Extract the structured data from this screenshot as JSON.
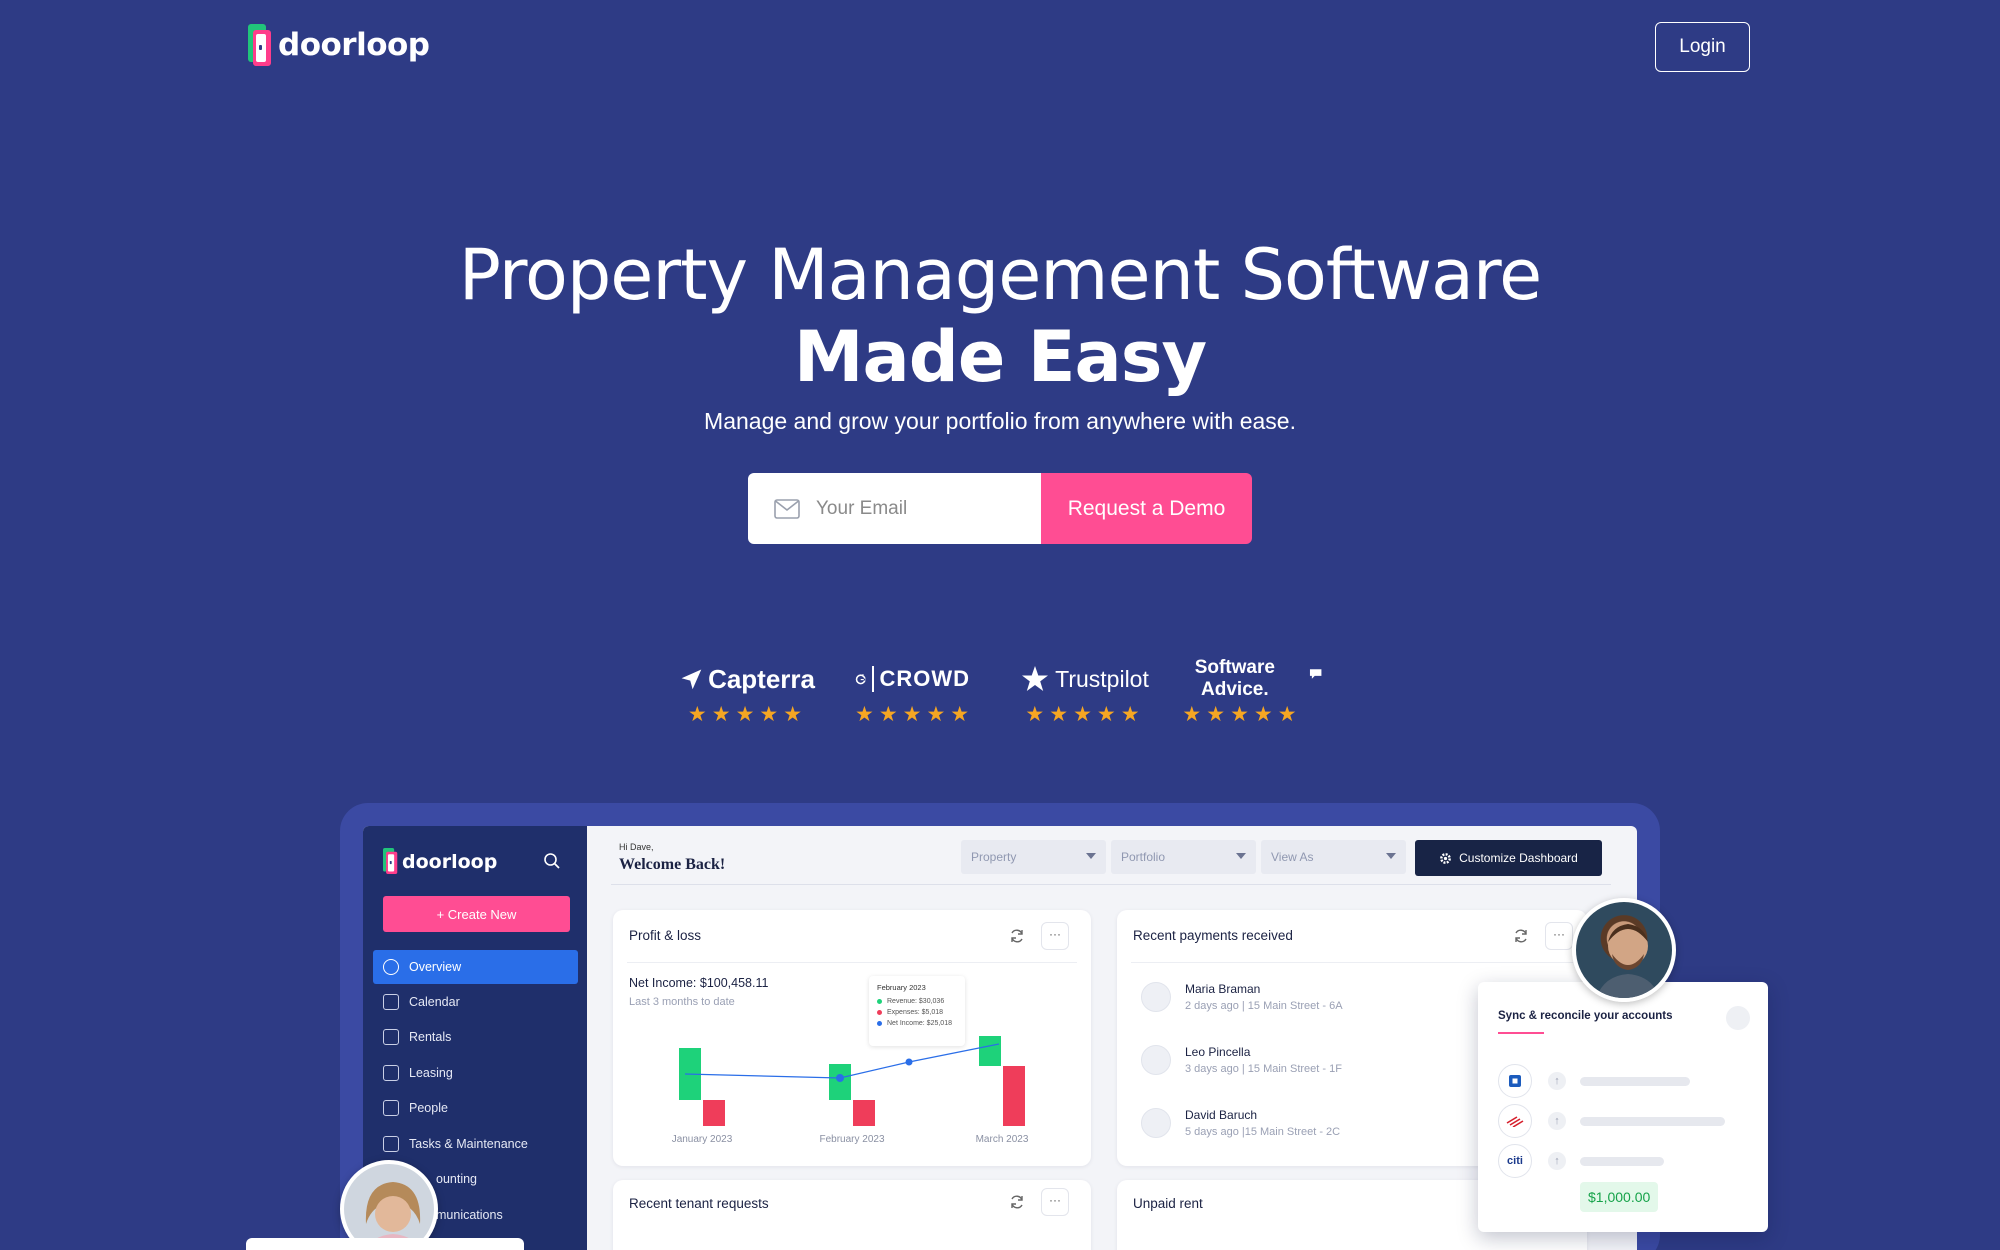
{
  "nav": {
    "logo_text": "doorloop",
    "login_label": "Login"
  },
  "hero": {
    "title_line1": "Property Management Software",
    "title_line2": "Made Easy",
    "subtitle": "Manage and grow your portfolio from anywhere with ease.",
    "email_placeholder": "Your Email",
    "cta_label": "Request a Demo"
  },
  "reviews": [
    {
      "name": "Capterra",
      "stars": "★★★★★"
    },
    {
      "name": "CROWD",
      "stars": "★★★★★"
    },
    {
      "name": "Trustpilot",
      "stars": "★★★★★"
    },
    {
      "name": "Software Advice.",
      "stars": "★★★★★"
    }
  ],
  "colors": {
    "background": "#2e3b85",
    "accent_pink": "#ff4d93",
    "brand_green": "#21c47a",
    "sidebar": "#1f2f6b",
    "active_blue": "#2a6ee8"
  },
  "dashboard": {
    "logo_text": "doorloop",
    "create_label": "+ Create New",
    "sidebar_items": [
      {
        "label": "Overview",
        "icon": "pie-chart-icon"
      },
      {
        "label": "Calendar",
        "icon": "calendar-icon"
      },
      {
        "label": "Rentals",
        "icon": "building-icon"
      },
      {
        "label": "Leasing",
        "icon": "document-icon"
      },
      {
        "label": "People",
        "icon": "people-icon"
      },
      {
        "label": "Tasks & Maintenance",
        "icon": "checklist-icon"
      },
      {
        "label": "ounting",
        "icon": "accounting-icon"
      },
      {
        "label": "munications",
        "icon": "chat-icon"
      }
    ],
    "greeting": "Hi Dave,",
    "welcome": "Welcome Back!",
    "filters": [
      "Property",
      "Portfolio",
      "View As"
    ],
    "customize_label": "Customize Dashboard",
    "profit_loss": {
      "title": "Profit & loss",
      "net_income": "Net Income: $100,458.11",
      "period": "Last 3 months to date",
      "tooltip_title": "February 2023",
      "tooltip_rows": [
        {
          "label": "Revenue: $30,036",
          "color": "#1ed27a"
        },
        {
          "label": "Expenses: $5,018",
          "color": "#ef3d5a"
        },
        {
          "label": "Net Income: $25,018",
          "color": "#2a6ee8"
        }
      ],
      "months": [
        "January 2023",
        "February 2023",
        "March 2023"
      ]
    },
    "payments": {
      "title": "Recent payments received",
      "rows": [
        {
          "name": "Maria Braman",
          "meta": "2 days ago | 15 Main Street - 6A"
        },
        {
          "name": "Leo Pincella",
          "meta": "3 days ago | 15 Main Street - 1F"
        },
        {
          "name": "David Baruch",
          "meta": "5 days ago |15 Main Street - 2C"
        }
      ]
    },
    "tenant_requests_title": "Recent tenant requests",
    "unpaid_rent_title": "Unpaid rent",
    "more_label": "···"
  },
  "sync": {
    "title": "Sync & reconcile your accounts",
    "banks": [
      "chase-icon",
      "bank-of-america-icon",
      "citi"
    ],
    "citi_label": "citi",
    "amount": "$1,000.00"
  }
}
